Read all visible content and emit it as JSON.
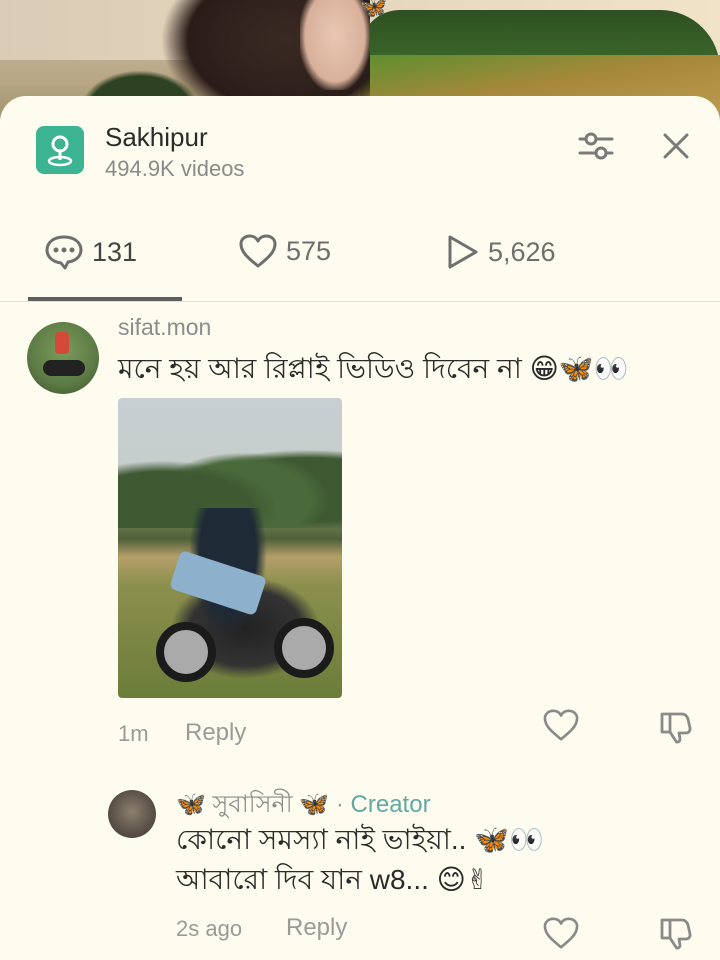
{
  "header": {
    "title": "Sakhipur",
    "subtitle": "494.9K videos"
  },
  "stats": {
    "comments": "131",
    "likes": "575",
    "views": "5,626"
  },
  "comments": [
    {
      "username": "sifat.mon",
      "text": "মনে হয় আর রিপ্লাই ভিডিও দিবেন না 😁🦋👀",
      "time": "1m",
      "reply_label": "Reply"
    }
  ],
  "replies": [
    {
      "username": "🦋 সুবাসিনী 🦋",
      "creator_label": "Creator",
      "line1": "কোনো সমস্যা নাই ভাইয়া.. 🦋👀",
      "line2": "আবারো দিব যান w8... 😊✌",
      "time": "2s ago",
      "reply_label": "Reply"
    }
  ],
  "colors": {
    "accent": "#3cb491",
    "creator": "#62a9a4",
    "panel_bg": "#fdfcee"
  }
}
